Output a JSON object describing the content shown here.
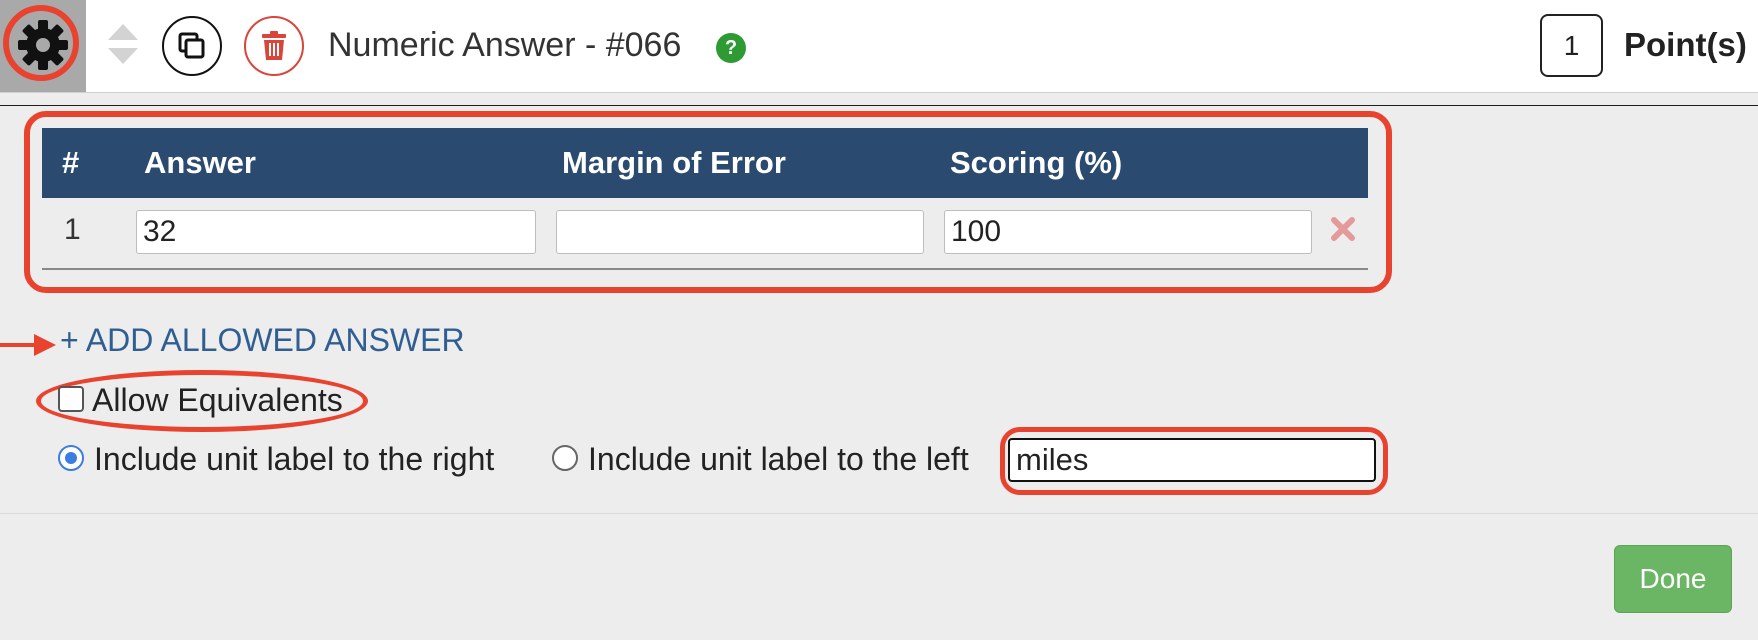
{
  "header": {
    "icons": [
      "gear-icon",
      "reorder-arrows-icon",
      "copy-icon",
      "trash-icon",
      "help-icon"
    ],
    "title": "Numeric Answer - #066",
    "help_glyph": "?",
    "points_value": "1",
    "points_label": "Point(s)"
  },
  "answers_table": {
    "columns": [
      "#",
      "Answer",
      "Margin of Error",
      "Scoring (%)"
    ],
    "rows": [
      {
        "index": "1",
        "answer": "32",
        "margin_of_error": "",
        "scoring": "100"
      }
    ],
    "remove_icon": "close-x-icon"
  },
  "add_answer_label": "+ ADD ALLOWED ANSWER",
  "allow_equivalents": {
    "label": "Allow Equivalents",
    "checked": false
  },
  "unit_label": {
    "options": [
      {
        "label": "Include unit label to the right",
        "selected": true
      },
      {
        "label": "Include unit label to the left",
        "selected": false
      }
    ],
    "value": "miles"
  },
  "done_label": "Done",
  "colors": {
    "header_bg": "#ffffff",
    "table_header_bg": "#2b4a70",
    "highlight": "#e8432f",
    "link": "#2f5e93",
    "done": "#6bb664",
    "help": "#2e9a34",
    "delete": "#d9453a"
  }
}
